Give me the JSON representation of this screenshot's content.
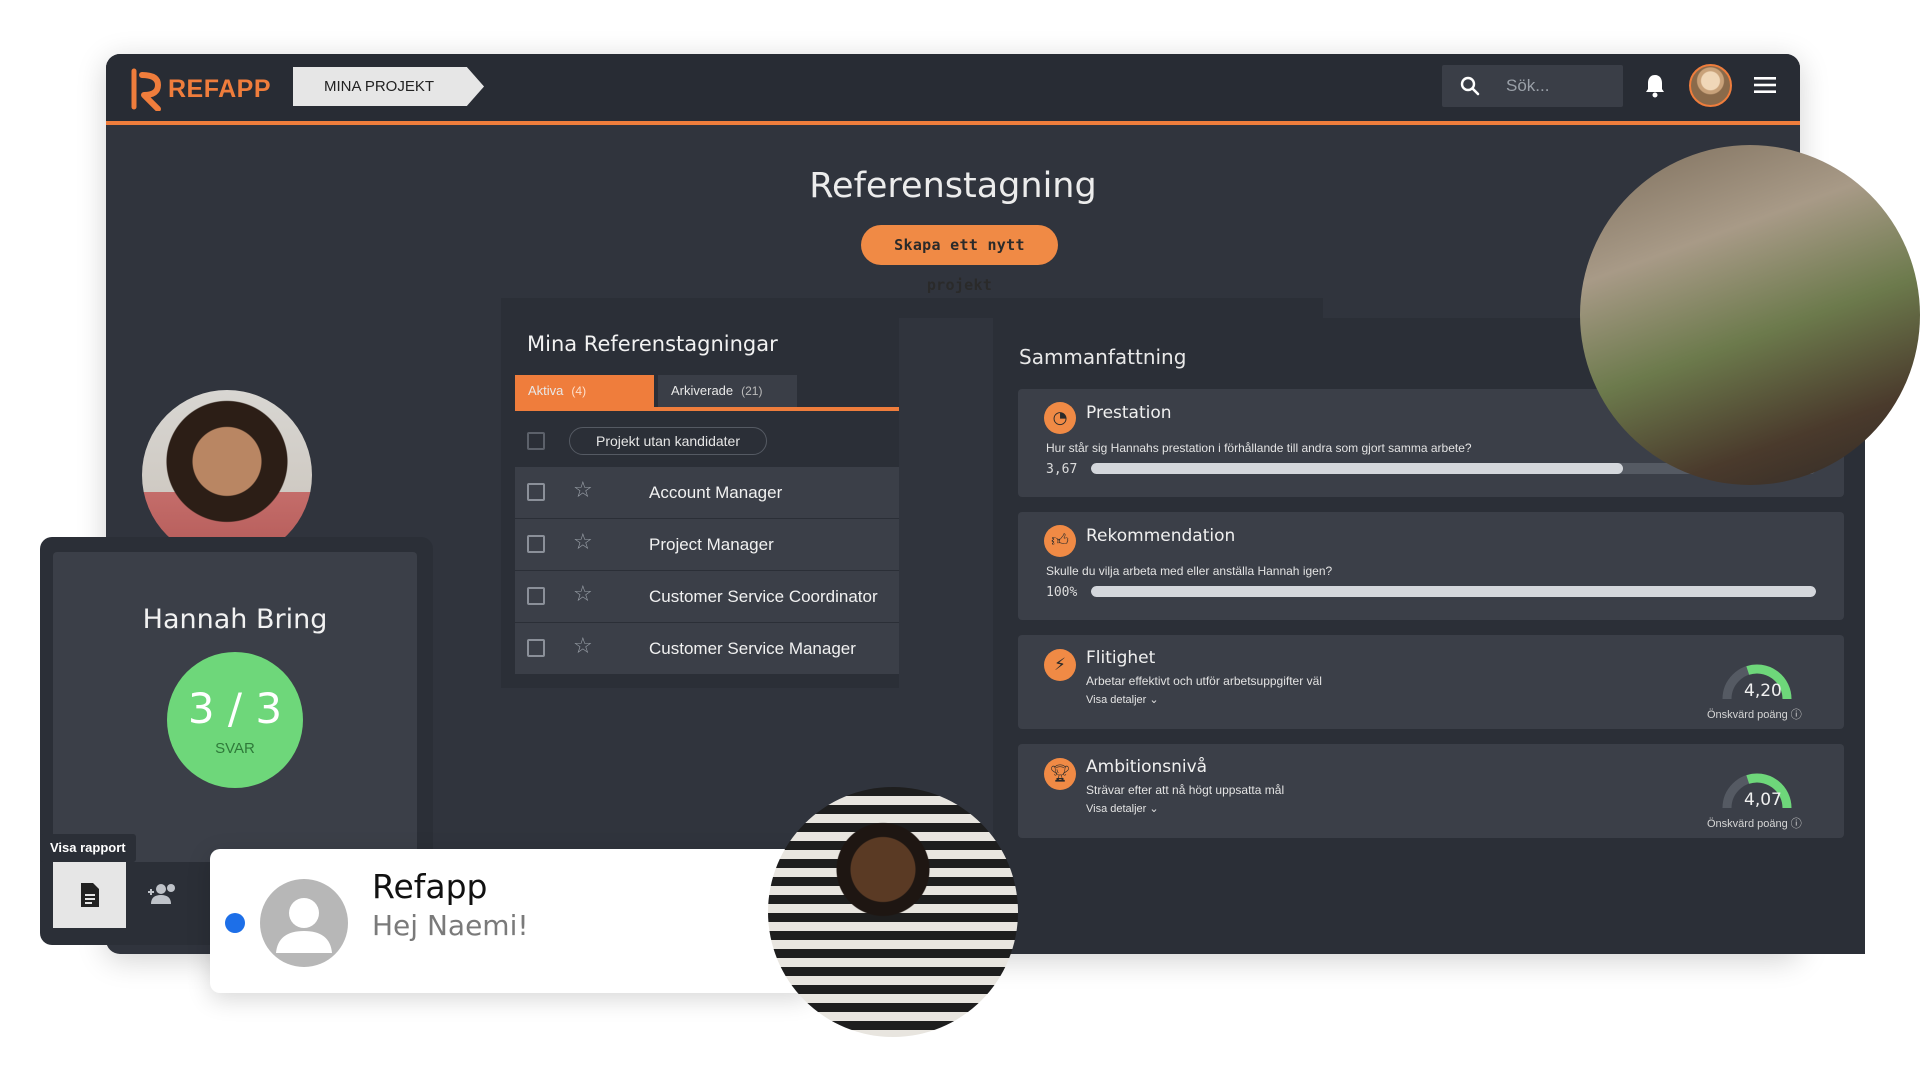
{
  "app": {
    "logo_text": "REFAPP",
    "breadcrumb": "MINA PROJEKT"
  },
  "search": {
    "placeholder": "Sök..."
  },
  "page": {
    "title": "Referenstagning",
    "create_button": "Skapa ett nytt projekt"
  },
  "list": {
    "title": "Mina Referenstagningar",
    "tabs": [
      {
        "label": "Aktiva",
        "count": "(4)"
      },
      {
        "label": "Arkiverade",
        "count": "(21)"
      }
    ],
    "filter_label": "Projekt utan kandidater",
    "items": [
      {
        "label": "Account Manager"
      },
      {
        "label": "Project Manager"
      },
      {
        "label": "Customer Service Coordinator"
      },
      {
        "label": "Customer Service Manager"
      }
    ]
  },
  "summary": {
    "title": "Sammanfattning",
    "cards": [
      {
        "title": "Prestation",
        "question": "Hur står sig Hannahs prestation i förhållande till andra som gjort samma arbete?",
        "value": "3,67",
        "fill": 0.734
      },
      {
        "title": "Rekommendation",
        "question": "Skulle du vilja arbeta med eller anställa Hannah igen?",
        "value": "100%",
        "fill": 1.0
      },
      {
        "title": "Flitighet",
        "subtitle": "Arbetar effektivt och utför arbetsuppgifter väl",
        "details": "Visa detaljer",
        "score": "4,20",
        "score_label": "Önskvärd poäng",
        "gauge_fill": 0.84
      },
      {
        "title": "Ambitionsnivå",
        "subtitle": "Strävar efter att nå högt uppsatta mål",
        "details": "Visa detaljer",
        "score": "4,07",
        "score_label": "Önskvärd poäng",
        "gauge_fill": 0.81
      }
    ]
  },
  "candidate": {
    "name": "Hannah Bring",
    "score": "3 / 3",
    "score_label": "SVAR",
    "tooltip": "Visa rapport"
  },
  "notification": {
    "title": "Refapp",
    "message": "Hej Naemi!"
  },
  "colors": {
    "accent": "#ef7d3c",
    "panel": "#2b2f37",
    "card": "#3b3f48",
    "success": "#6ed77a",
    "unread": "#1d6fe8"
  }
}
